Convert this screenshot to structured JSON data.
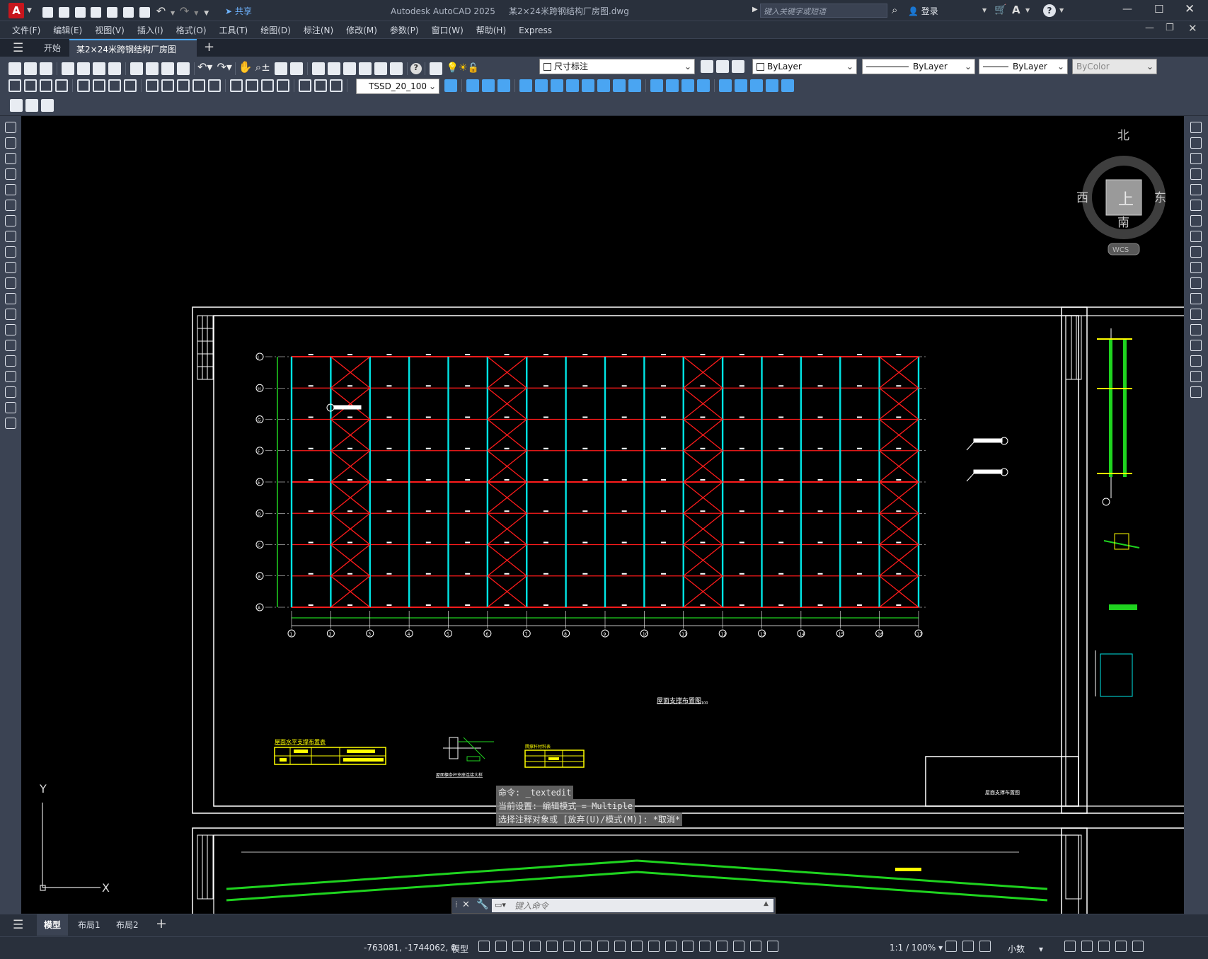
{
  "titlebar": {
    "app_letter": "A",
    "share_label": "共享",
    "title": "Autodesk AutoCAD 2025",
    "filename": "某2×24米跨钢结构厂房图.dwg",
    "search_placeholder": "键入关键字或短语",
    "login_label": "登录"
  },
  "menu": [
    "文件(F)",
    "编辑(E)",
    "视图(V)",
    "插入(I)",
    "格式(O)",
    "工具(T)",
    "绘图(D)",
    "标注(N)",
    "修改(M)",
    "参数(P)",
    "窗口(W)",
    "帮助(H)",
    "Express"
  ],
  "doc_tabs": {
    "start": "开始",
    "active": "某2×24米跨钢结构厂房图*"
  },
  "toolbar": {
    "layer_name": "尺寸标注",
    "color": "ByLayer",
    "linetype": "ByLayer",
    "lineweight": "ByLayer",
    "plotstyle": "ByColor",
    "dimstyle": "TSSD_20_100"
  },
  "viewcube": {
    "north": "北",
    "south": "南",
    "east": "东",
    "west": "西",
    "face": "上",
    "wcs": "WCS"
  },
  "drawing": {
    "main_title": "屋面支撑布置图",
    "scale_label": "1:100",
    "titleblock_text": "屋面支撑布置图",
    "table1_title": "屋面水平支撑布置表",
    "table2_title": "隅撑杆材料表",
    "detail_title": "屋面檩条杆支座连接大样",
    "row_labels": [
      "J",
      "H",
      "G",
      "F",
      "E",
      "D",
      "C",
      "B",
      "A"
    ],
    "col_labels": [
      "1",
      "2",
      "3",
      "4",
      "5",
      "6",
      "7",
      "8",
      "9",
      "10",
      "11",
      "12",
      "13",
      "14",
      "15",
      "16",
      "17"
    ]
  },
  "command": {
    "line1": "命令: _textedit",
    "line2": "当前设置: 编辑模式 = Multiple",
    "line3": "选择注释对象或 [放弃(U)/模式(M)]: *取消*",
    "input_placeholder": "键入命令"
  },
  "layout_tabs": [
    "模型",
    "布局1",
    "布局2"
  ],
  "status": {
    "coords": "-763081, -1744062, 0",
    "model": "模型",
    "scale": "1:1 / 100%",
    "units": "小数"
  },
  "ucs": {
    "x": "X",
    "y": "Y"
  },
  "colors": {
    "red": "#ff1b1b",
    "cyan": "#00e5e5",
    "green": "#1fd31f",
    "yellow": "#ffff00",
    "white": "#ffffff"
  }
}
